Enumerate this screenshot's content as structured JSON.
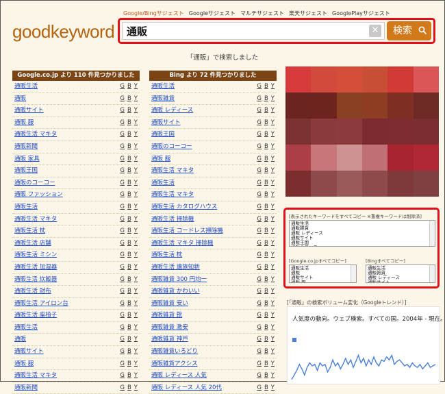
{
  "nav": [
    "Google/Bingサジェスト",
    "Googleサジェスト",
    "マルチサジェスト",
    "楽天サジェスト",
    "GooglePlayサジェスト"
  ],
  "logo": "goodkeyword",
  "search": {
    "value": "通販",
    "clear_label": "✕",
    "button_label": "検索"
  },
  "status_text": "「通販」で検索しました",
  "google": {
    "header": "Google.co.jp より 110 件見つかりました",
    "items": [
      "通販生活",
      "通販",
      "通販サイト",
      "通販 服",
      "通販生活 マキタ",
      "通販新聞",
      "通販 家具",
      "通販王国",
      "通販のコーコー",
      "通販 ファッション",
      "通販生活",
      "通販生活 マキタ",
      "通販生活 枕",
      "通販生活 店舗",
      "通販生活 ミシン",
      "通販生活 加湿器",
      "通販生活 炊飯器",
      "通販生活 財布",
      "通販生活 アイロン台",
      "通販生活 座椅子",
      "通販生活",
      "通販",
      "通販サイト",
      "通販 服",
      "通販生活 マキタ",
      "通販新聞"
    ]
  },
  "bing": {
    "header": "Bing より 72 件見つかりました",
    "items": [
      "通販生活",
      "通販雑貨",
      "通販 レディース",
      "通販サイト",
      "通販王国",
      "通販のコーコー",
      "通販 服",
      "通販生活 マキタ",
      "通販生活",
      "通販生活 マキタ",
      "通販生活 カタログハウス",
      "通販生活 掃除機",
      "通販生活 コードレス掃除機",
      "通販生活 マキタ 掃除機",
      "通販生活 枕",
      "通販生活 遺族知新",
      "通販雑貨 300 円均一",
      "通販雑貨 かわいい",
      "通販雑貨 安い",
      "通販雑貨 靴",
      "通販雑貨 激安",
      "通販雑貨 神戸",
      "通販雑貨いろどり",
      "通販雑貨アクシス",
      "通販 レディース 人気",
      "通販 レディース 人気 20代"
    ]
  },
  "gby_labels": [
    "G",
    "B",
    "Y"
  ],
  "mosaic_colors": [
    "#d63a3a",
    "#d14a3b",
    "#d44e3a",
    "#c84f35",
    "#d23a35",
    "#db5656",
    "#6c2420",
    "#6d241f",
    "#8a4122",
    "#8e3d22",
    "#7e2e22",
    "#6f2a26",
    "#7d3232",
    "#8a3a3a",
    "#8c3a3c",
    "#7d2a30",
    "#7e2c31",
    "#7b2e32",
    "#ab3e46",
    "#c9767a",
    "#cf9292",
    "#c07074",
    "#a8242e",
    "#b02833",
    "#7a2e2e",
    "#8e4a4a",
    "#9a5a5a",
    "#8e4a4a",
    "#7e3a3a",
    "#7e4040"
  ],
  "copy": {
    "title": "[表示されたキーワードをすべてコピー ※重複キーワードは削除済]",
    "all_lines": [
      "通販生活",
      "通販雑貨",
      "通販 レディース",
      "通販サイト",
      "通販王国",
      "通販のコーコー"
    ],
    "google_label": "[Google.co.jpすべてコピー]",
    "google_lines": [
      "通販生活",
      "通販",
      "通販サイト",
      "通販 服"
    ],
    "bing_label": "[Bingすべてコピー]",
    "bing_lines": [
      "通販生活",
      "通販雑貨",
      "通販 レディース",
      "通販サイト"
    ]
  },
  "trend": {
    "title": "[「通販」の検索ボリューム変化（Googleトレンド）]",
    "desc": "人気度の動向。ウェブ検索。すべての国。2004年 - 現在。",
    "series_values": [
      0.05,
      0.2,
      0.35,
      0.55,
      0.4,
      0.2,
      0.45,
      0.6,
      0.5,
      0.55,
      0.35,
      0.6,
      0.5,
      0.55,
      0.3,
      0.45,
      0.7,
      0.5,
      0.6,
      0.4,
      0.55,
      0.75,
      0.55,
      0.7,
      0.45,
      0.65,
      0.85,
      0.6,
      0.75,
      0.5,
      0.7,
      0.55,
      0.8,
      0.6,
      0.5,
      0.7,
      0.65,
      0.8,
      0.7,
      0.85,
      0.55,
      0.65,
      0.7,
      0.6,
      0.5,
      0.55,
      0.45,
      0.6,
      0.5,
      0.45,
      0.55,
      0.4,
      0.5,
      0.6,
      0.45,
      0.5,
      0.55
    ]
  },
  "colors": {
    "accent": "#d2791a",
    "header": "#7b4414",
    "link": "#1e49c8",
    "highlight": "#e0111b",
    "line": "#4a7fd8"
  }
}
